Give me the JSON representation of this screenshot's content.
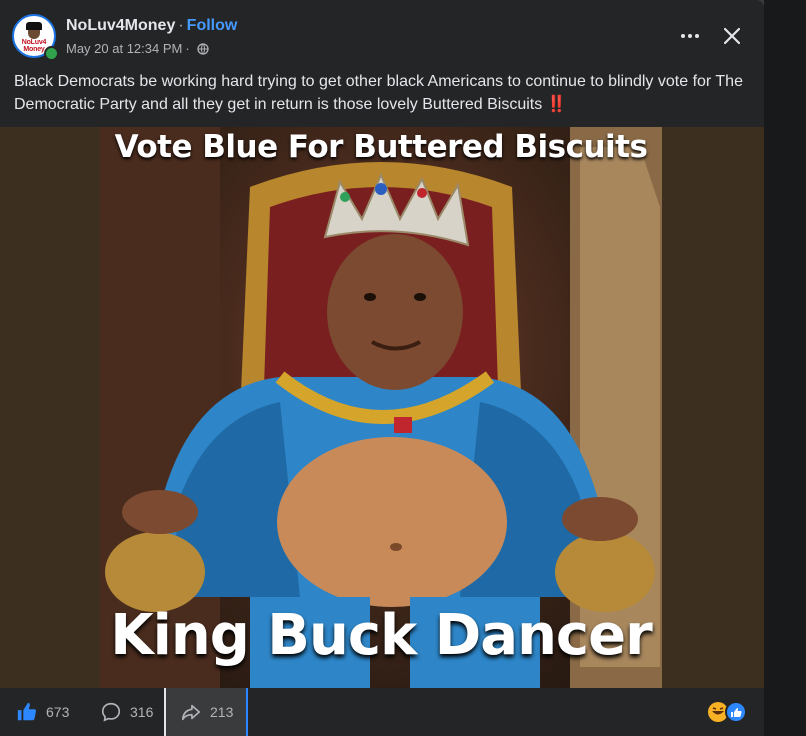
{
  "post": {
    "author": "NoLuv4Money",
    "separator": "·",
    "follow_label": "Follow",
    "timestamp": "May 20 at 12:34 PM",
    "meta_separator": "·",
    "privacy_icon": "globe-icon",
    "avatar_text_1": "NoLuv4",
    "avatar_text_2": "Money",
    "caption": "Black Democrats be working hard trying to get other black Americans to continue to blindly vote for The Democratic Party and all they get in return is those lovely Buttered Biscuits",
    "caption_emoji": "‼️"
  },
  "image": {
    "top_text": "Vote Blue For Buttered Biscuits",
    "bottom_text": "King Buck Dancer"
  },
  "actions": {
    "like_count": "673",
    "comment_count": "316",
    "share_count": "213"
  },
  "colors": {
    "accent": "#4599ff",
    "background": "#242526",
    "online": "#31a24c"
  }
}
